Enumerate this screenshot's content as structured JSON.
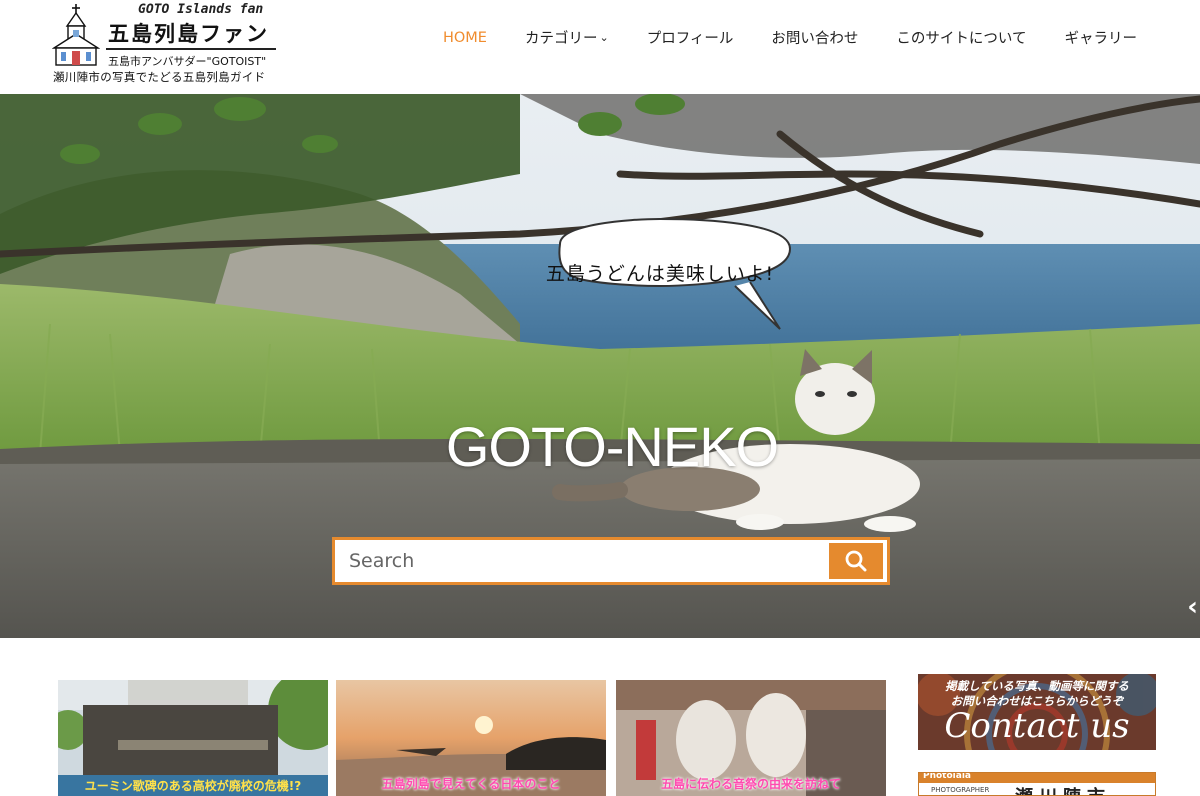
{
  "header": {
    "logo": {
      "en": "GOTO Islands fan",
      "jp": "五島列島ファン",
      "sub1": "五島市アンバサダー\"GOTOIST\"",
      "sub2": "瀬川陣市の写真でたどる五島列島ガイド"
    },
    "nav": [
      {
        "label": "HOME",
        "active": true
      },
      {
        "label": "カテゴリー",
        "dropdown": true
      },
      {
        "label": "プロフィール"
      },
      {
        "label": "お問い合わせ"
      },
      {
        "label": "このサイトについて"
      },
      {
        "label": "ギャラリー"
      }
    ]
  },
  "hero": {
    "speech_bubble": "五島うどんは美味しいよ!",
    "title": "GOTO-NEKO",
    "search": {
      "placeholder": "Search",
      "value": ""
    },
    "slider_arrow": "‹"
  },
  "cards": [
    {
      "caption": "ユーミン歌碑のある高校が廃校の危機!?"
    },
    {
      "caption": "五島列島で見えてくる日本のこと"
    },
    {
      "caption": "五島に伝わる音祭の由来を訪ねて"
    }
  ],
  "sidebar": {
    "contact_banner": {
      "line1": "掲載している写真、動画等に関する",
      "line2": "お問い合わせはこちらからどうぞ",
      "big": "Contact us"
    },
    "photographer_banner": {
      "brand": "Photolala",
      "role": "PHOTOGRAPHER",
      "name": "瀬川陣市"
    }
  },
  "colors": {
    "accent": "#f08c2e",
    "search_border": "#e58a2e",
    "text": "#222222"
  },
  "icons": [
    "church-logo-icon",
    "chevron-down-icon",
    "search-icon",
    "chevron-left-icon"
  ]
}
